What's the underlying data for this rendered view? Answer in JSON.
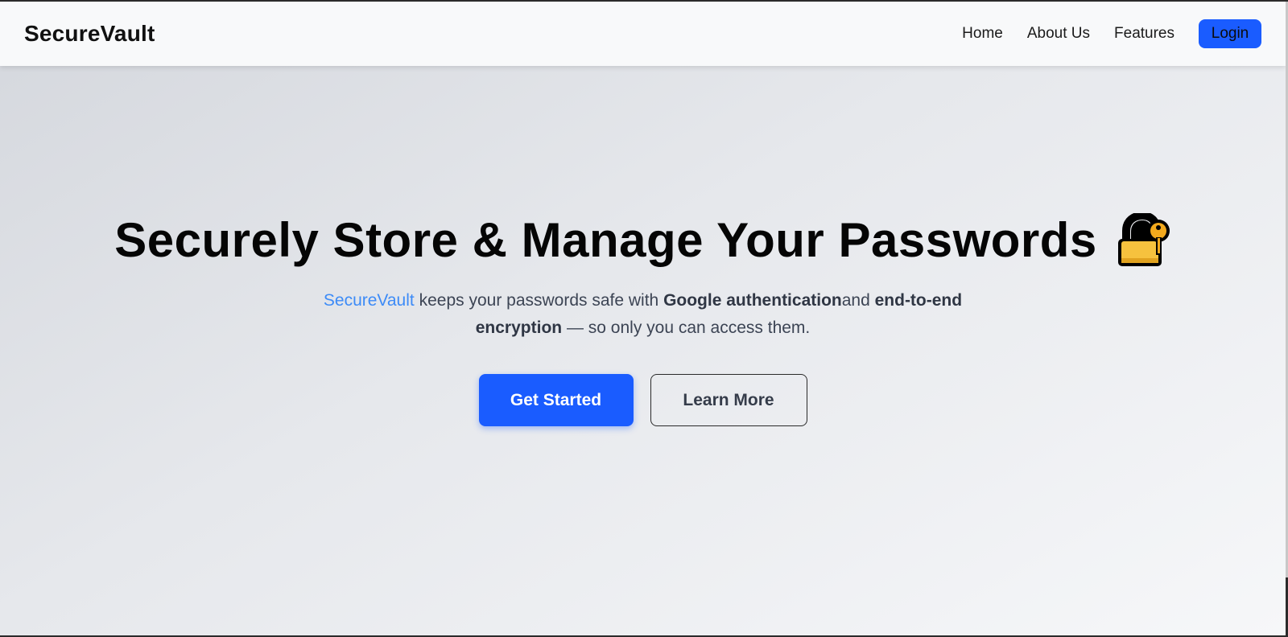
{
  "navbar": {
    "brand": "SecureVault",
    "links": [
      "Home",
      "About Us",
      "Features"
    ],
    "login_label": "Login"
  },
  "hero": {
    "headline": "Securely Store & Manage Your Passwords",
    "headline_icon": "lock-with-key-icon",
    "subtitle": {
      "brand": "SecureVault",
      "part1": " keeps your passwords safe with ",
      "strong1": "Google authentication",
      "part2": "and ",
      "strong2": "end-to-end encryption",
      "part3": " — so only you can access them."
    },
    "primary_cta": "Get Started",
    "secondary_cta": "Learn More"
  },
  "colors": {
    "accent": "#1a5cff",
    "brand_text": "#3d8bf7",
    "lock_body": "#f6c23e",
    "key": "#f2a91d"
  }
}
